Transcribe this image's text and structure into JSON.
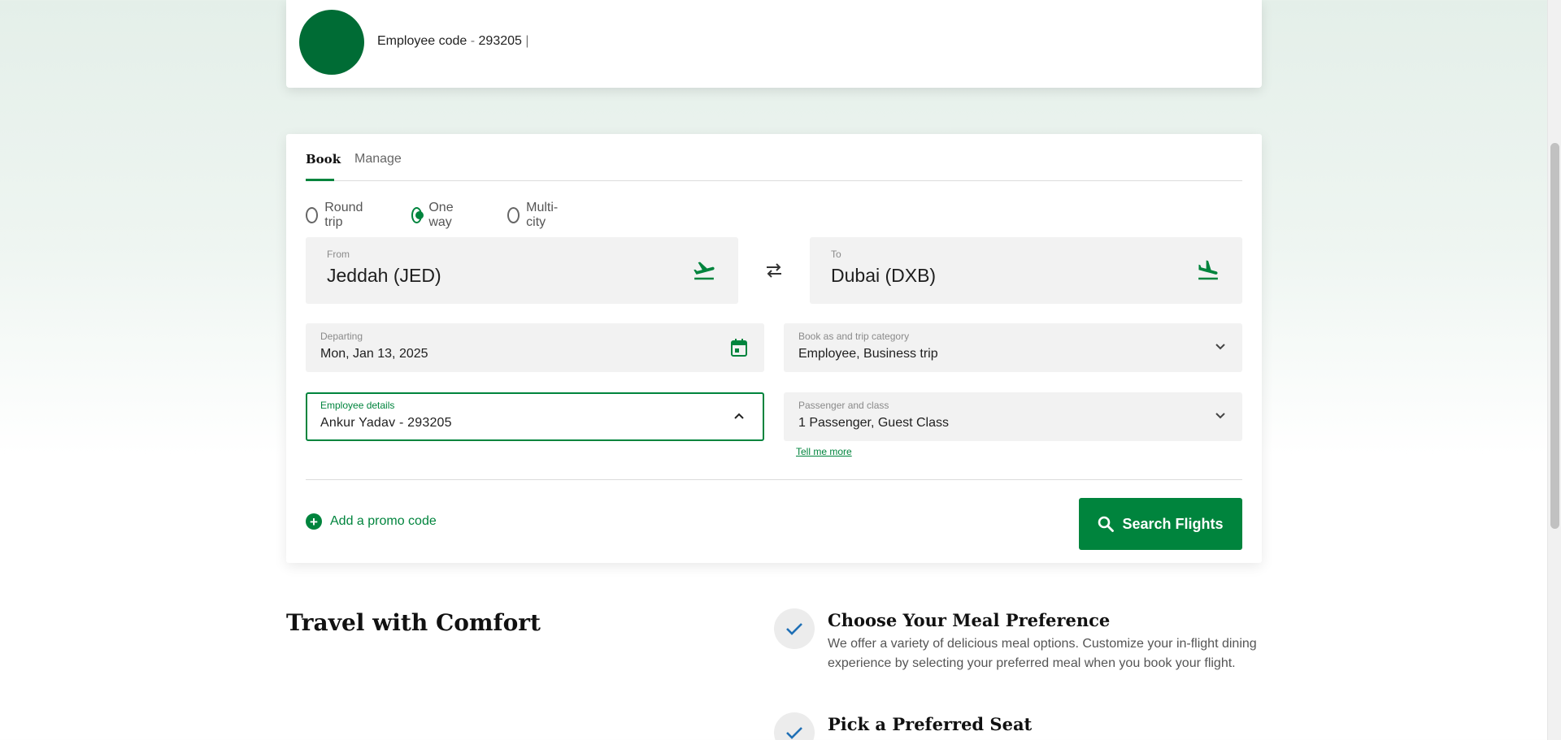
{
  "employee": {
    "code_label": "Employee code",
    "separator": "-",
    "code_value": "293205",
    "cursor": "|"
  },
  "tabs": [
    {
      "label": "Book",
      "active": true
    },
    {
      "label": "Manage",
      "active": false
    }
  ],
  "trip_types": [
    {
      "label": "Round trip",
      "selected": false
    },
    {
      "label": "One way",
      "selected": true
    },
    {
      "label": "Multi-city",
      "selected": false
    }
  ],
  "from": {
    "label": "From",
    "value": "Jeddah (JED)",
    "icon": "plane-takeoff-icon"
  },
  "to": {
    "label": "To",
    "value": "Dubai (DXB)",
    "icon": "plane-landing-icon"
  },
  "departing": {
    "label": "Departing",
    "value": "Mon, Jan 13, 2025",
    "icon": "calendar-icon"
  },
  "category": {
    "label": "Book as and trip category",
    "value": "Employee, Business trip"
  },
  "employee_details": {
    "label": "Employee details",
    "value": "Ankur  Yadav - 293205"
  },
  "passenger": {
    "label": "Passenger and class",
    "value": "1 Passenger, Guest Class",
    "help_link": "Tell me more"
  },
  "promo": {
    "label": "Add a promo code"
  },
  "search": {
    "label": "Search Flights"
  },
  "travel": {
    "title": "Travel with Comfort",
    "features": [
      {
        "title": "Choose Your Meal Preference",
        "description": "We offer a variety of delicious meal options. Customize your in-flight dining experience by selecting your preferred meal when you book your flight."
      },
      {
        "title": "Pick a Preferred Seat",
        "description": ""
      }
    ]
  },
  "colors": {
    "brand_green": "#00843d",
    "avatar_green": "#006c35"
  }
}
